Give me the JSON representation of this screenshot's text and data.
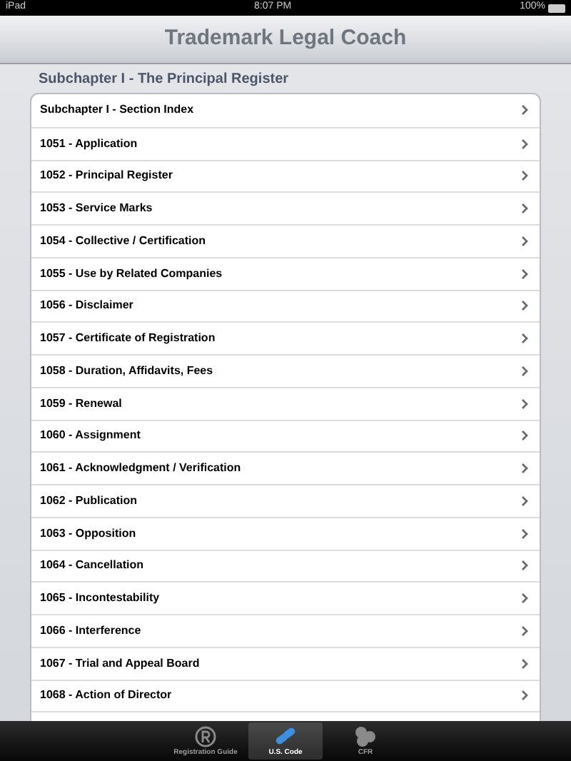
{
  "status_bar": {
    "device": "iPad",
    "time": "8:07 PM",
    "battery": "100%"
  },
  "nav_bar": {
    "title": "Trademark Legal Coach"
  },
  "section": {
    "header": "Subchapter I - The Principal Register",
    "rows": [
      {
        "label": "Subchapter I - Section Index"
      },
      {
        "label": "1051 - Application"
      },
      {
        "label": "1052 - Principal Register"
      },
      {
        "label": "1053 - Service Marks"
      },
      {
        "label": "1054 - Collective / Certification"
      },
      {
        "label": "1055 - Use by Related Companies"
      },
      {
        "label": "1056 - Disclaimer"
      },
      {
        "label": "1057 - Certificate of Registration"
      },
      {
        "label": "1058 - Duration, Affidavits, Fees"
      },
      {
        "label": "1059 - Renewal"
      },
      {
        "label": "1060 - Assignment"
      },
      {
        "label": "1061 - Acknowledgment / Verification"
      },
      {
        "label": "1062 - Publication"
      },
      {
        "label": "1063 - Opposition"
      },
      {
        "label": "1064 - Cancellation"
      },
      {
        "label": "1065 - Incontestability"
      },
      {
        "label": "1066 - Interference"
      },
      {
        "label": "1067 - Trial and Appeal Board"
      },
      {
        "label": "1068 - Action of Director"
      }
    ]
  },
  "tab_bar": [
    {
      "kind": "registered",
      "label": "Registration Guide",
      "selected": false
    },
    {
      "kind": "pills",
      "label": "U.S. Code",
      "selected": true
    },
    {
      "kind": "blobs",
      "label": "CFR",
      "selected": false
    }
  ]
}
